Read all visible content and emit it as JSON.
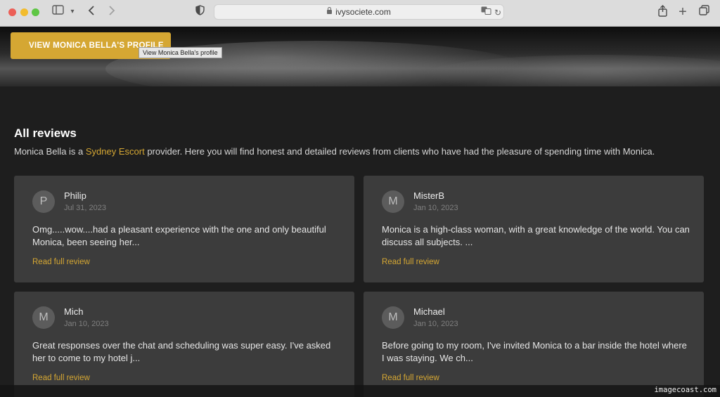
{
  "browser": {
    "url": "ivysociete.com"
  },
  "hero": {
    "button_label": "VIEW MONICA BELLA'S PROFILE",
    "tooltip": "View Monica Bella's profile"
  },
  "reviews": {
    "title": "All reviews",
    "desc_prefix": "Monica Bella is a ",
    "desc_link": "Sydney Escort",
    "desc_suffix": " provider. Here you will find honest and detailed reviews from clients who have had the pleasure of spending time with Monica.",
    "items": [
      {
        "initial": "P",
        "name": "Philip",
        "date": "Jul 31, 2023",
        "text": "Omg.....wow....had a pleasant experience with the one and only beautiful Monica, been seeing her...",
        "link": "Read full review"
      },
      {
        "initial": "M",
        "name": "MisterB",
        "date": "Jan 10, 2023",
        "text": "Monica is a high-class woman, with a great knowledge of the world. You can discuss all subjects. ...",
        "link": "Read full review"
      },
      {
        "initial": "M",
        "name": "Mich",
        "date": "Jan 10, 2023",
        "text": "Great responses over the chat and scheduling was super easy. I've asked her to come to my hotel j...",
        "link": "Read full review"
      },
      {
        "initial": "M",
        "name": "Michael",
        "date": "Jan 10, 2023",
        "text": "Before going to my room, I've invited Monica to a bar inside the hotel where I was staying. We ch...",
        "link": "Read full review"
      }
    ]
  },
  "watermark": "imagecoast.com",
  "colors": {
    "accent": "#d5a733",
    "card": "#3c3c3c",
    "background": "#1e1e1e"
  }
}
